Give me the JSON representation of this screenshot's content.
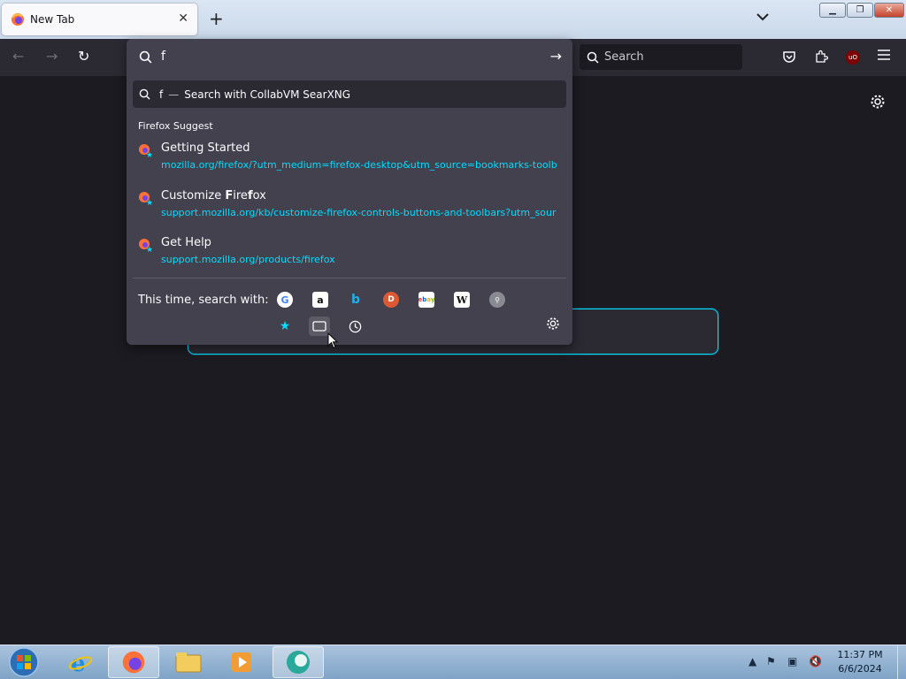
{
  "browser": {
    "tab_title": "New Tab",
    "tab_close": "✕",
    "new_tab": "+",
    "list_tabs": "⌄",
    "search_placeholder": "Search",
    "ublock_badge": "uO"
  },
  "urlbar": {
    "value": "f",
    "first_result": {
      "query": "f",
      "dash": "—",
      "label": "Search with CollabVM SearXNG"
    },
    "section_heading": "Firefox Suggest",
    "results": [
      {
        "title": "Getting Started",
        "url": "mozilla.org/firefox/?utm_medium=firefox-desktop&utm_source=bookmarks-toolba"
      },
      {
        "title_pre": "Customize ",
        "title_bold": "F",
        "title_mid": "ire",
        "title_bold2": "f",
        "title_post": "ox",
        "url": "support.mozilla.org/kb/customize-firefox-controls-buttons-and-toolbars?utm_sour"
      },
      {
        "title": "Get Help",
        "url": "support.mozilla.org/products/firefox"
      }
    ],
    "one_off_label": "This time, search with:",
    "engines": [
      "google-icon",
      "amazon-icon",
      "bing-icon",
      "duckduckgo-icon",
      "ebay-icon",
      "wikipedia-icon",
      "searxng-icon"
    ],
    "modes": [
      "bookmarks-icon",
      "tabs-icon",
      "history-icon"
    ]
  },
  "taskbar": {
    "time": "11:37 PM",
    "date": "6/6/2024"
  },
  "colors": {
    "accent": "#00ddff",
    "toolbar": "#2b2a33",
    "popup": "#42414d",
    "page": "#1c1b22"
  }
}
